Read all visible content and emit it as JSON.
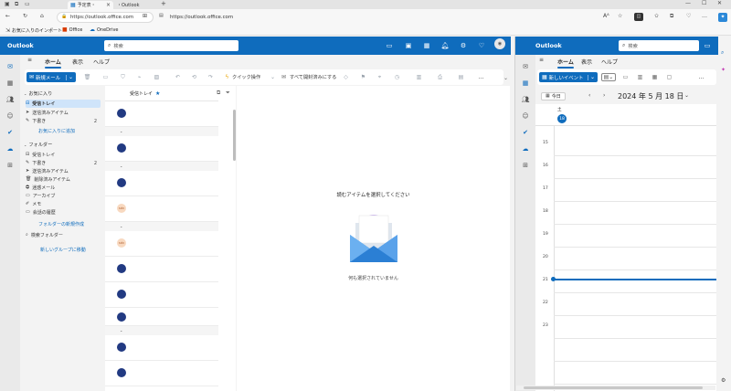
{
  "browser": {
    "tab1_label": "予定表・",
    "tab2_label": "・Outlook",
    "add_tab": "+",
    "addr_url": "https://outlook.office.com",
    "addr2_url": "https://outlook.office.com",
    "favorites": [
      "お気に入りのインポート",
      "Office",
      "OneDrive"
    ]
  },
  "mail": {
    "brand": "Outlook",
    "search_placeholder": "検索",
    "tabs": [
      "ホーム",
      "表示",
      "ヘルプ"
    ],
    "new_mail_label": "新規メール",
    "quick_action": "クイック操作",
    "mark_all_read": "すべて開封済みにする",
    "more": "…",
    "favorites_header": "お気に入り",
    "favorites": [
      {
        "label": "受信トレイ",
        "count": ""
      },
      {
        "label": "送信済みアイテム",
        "count": ""
      },
      {
        "label": "下書き",
        "count": "2"
      }
    ],
    "add_favorite": "お気に入りに追加",
    "folders_header": "フォルダー",
    "folders": [
      {
        "label": "受信トレイ",
        "count": ""
      },
      {
        "label": "下書き",
        "count": "2"
      },
      {
        "label": "送信済みアイテム",
        "count": ""
      },
      {
        "label": "削除済みアイテム",
        "count": ""
      },
      {
        "label": "迷惑メール",
        "count": ""
      },
      {
        "label": "アーカイブ",
        "count": ""
      },
      {
        "label": "メモ",
        "count": ""
      },
      {
        "label": "会話の履歴",
        "count": ""
      }
    ],
    "new_folder": "フォルダーの新規作成",
    "search_folder": "検索フォルダー",
    "new_group": "新しいグループに移動",
    "list_title": "受信トレイ",
    "avatar_initials": "sdv",
    "reading_title": "読むアイテムを選択してください",
    "reading_sub": "何も選択されていません"
  },
  "calendar": {
    "brand": "Outlook",
    "search_placeholder": "検索",
    "tabs": [
      "ホーム",
      "表示",
      "ヘルプ"
    ],
    "new_event_label": "新しいイベント",
    "today_label": "今日",
    "date_label": "2024 年 5 月 18 日",
    "weekday": "土",
    "day_num": "18",
    "hours": [
      "15",
      "16",
      "17",
      "18",
      "19",
      "20",
      "21",
      "22",
      "23"
    ]
  },
  "colors": {
    "brand": "#0f6cbd",
    "avatar": "#223a82",
    "avatar_peach": "#f8d9c0"
  }
}
